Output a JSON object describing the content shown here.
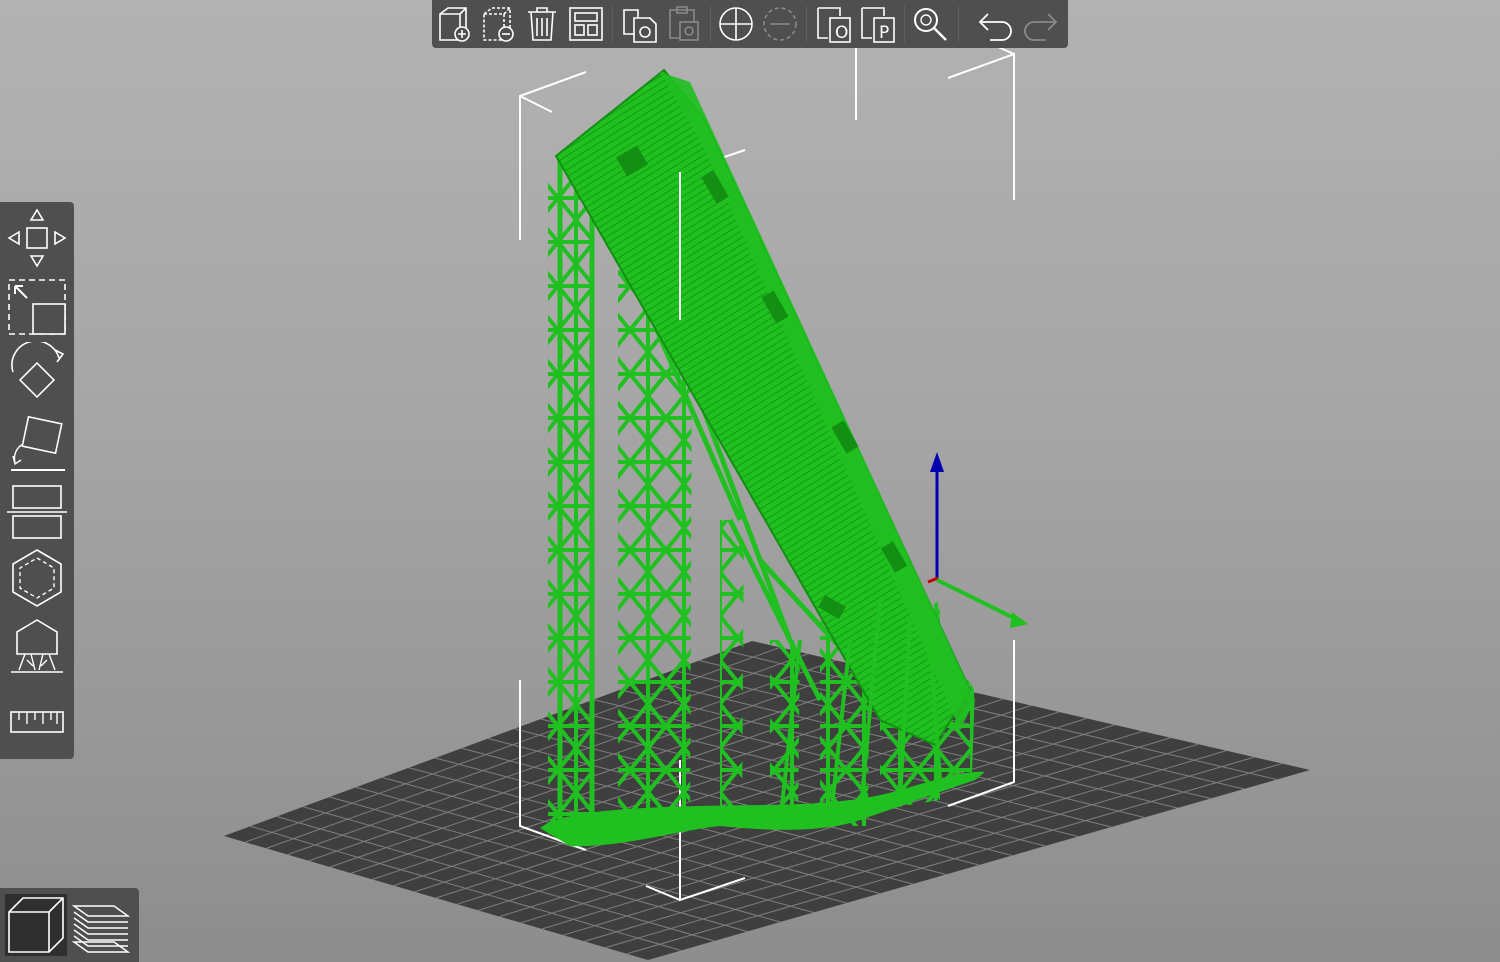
{
  "scene": {
    "model_color": "#1fc01f",
    "model_dark_color": "#138f13",
    "bed_color": "#3f3f3f",
    "grid_line_color": "#8a8a8a",
    "bbox_color": "#ffffff",
    "axis_z_color": "#0000b0",
    "axis_x_color": "#c00000",
    "axis_y_color": "#1fc01f",
    "background_top": "#b2b2b2",
    "background_bottom": "#8d8d8d"
  },
  "toolbar": {
    "color": "#4f4f4f",
    "icon_color": "#ffffff",
    "disabled_icon_color": "#8a8a8a",
    "items": [
      {
        "name": "add-icon",
        "enabled": true
      },
      {
        "name": "delete-icon",
        "enabled": true
      },
      {
        "name": "delete-all-icon",
        "enabled": true
      },
      {
        "name": "arrange-icon",
        "enabled": true
      },
      {
        "name": "copy-icon",
        "enabled": true
      },
      {
        "name": "paste-icon",
        "enabled": false
      },
      {
        "name": "add-instance-icon",
        "enabled": true
      },
      {
        "name": "remove-instance-icon",
        "enabled": false
      },
      {
        "name": "split-to-objects-icon",
        "enabled": true
      },
      {
        "name": "split-to-parts-icon",
        "enabled": true
      },
      {
        "name": "search-icon",
        "enabled": true
      },
      {
        "name": "undo-icon",
        "enabled": true
      },
      {
        "name": "redo-icon",
        "enabled": false
      }
    ]
  },
  "gizmos": {
    "items": [
      {
        "name": "move-icon"
      },
      {
        "name": "scale-icon"
      },
      {
        "name": "rotate-icon"
      },
      {
        "name": "place-on-face-icon"
      },
      {
        "name": "cut-icon"
      },
      {
        "name": "hollow-icon"
      },
      {
        "name": "support-points-icon"
      },
      {
        "name": "measure-icon"
      }
    ]
  },
  "view_toggle": {
    "items": [
      {
        "name": "3d-view-icon",
        "active": true
      },
      {
        "name": "preview-layers-icon",
        "active": false
      }
    ]
  }
}
